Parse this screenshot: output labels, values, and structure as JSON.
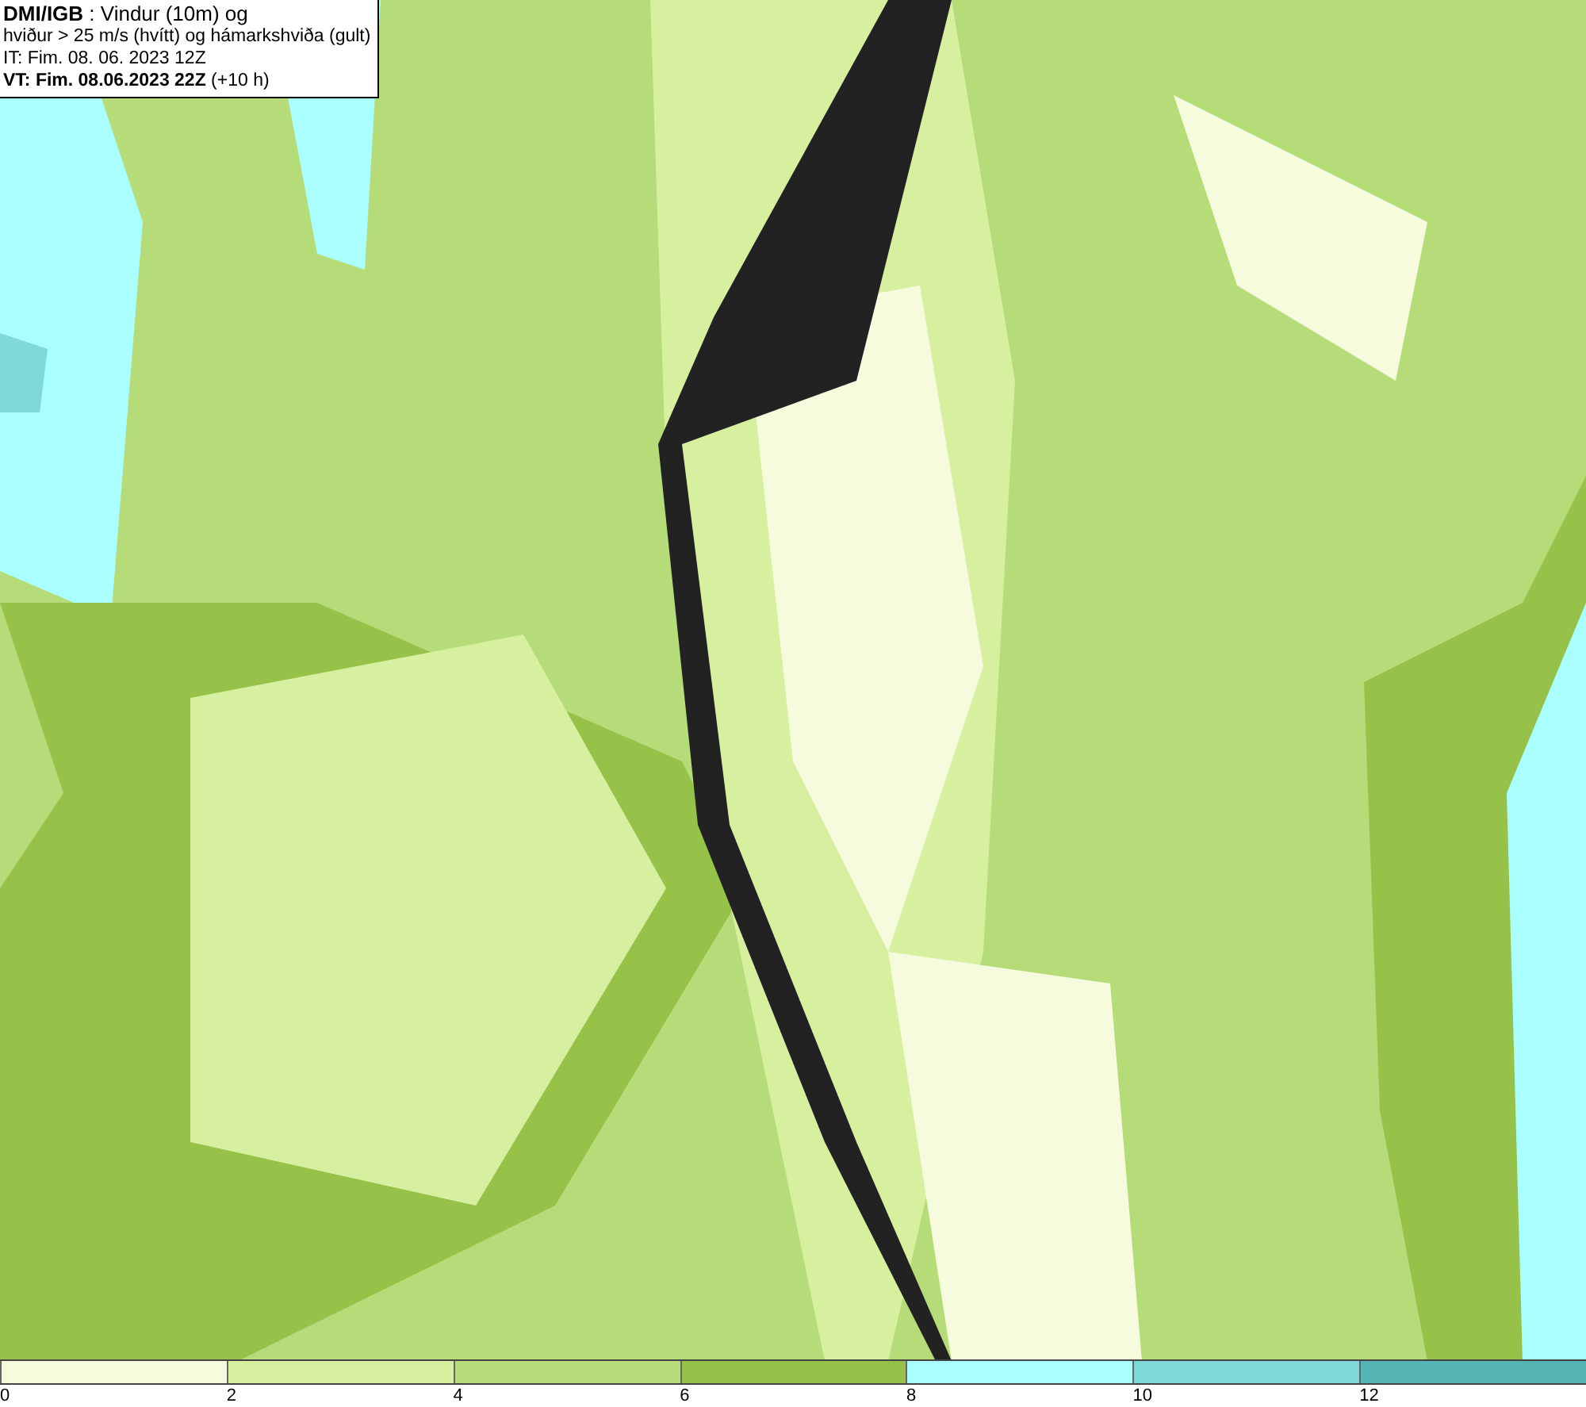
{
  "info_box": {
    "lines": [
      "**DMI/IGB** : Vindur (10m) og",
      "hviður > 25 m/s (hvítt) og hámarkshviða (gult)",
      "IT: Fim. 08. 06. 2023 12Z",
      "**VT: Fim. 08.06.2023 22Z** (+10 h)"
    ]
  },
  "legend": {
    "bins": [
      {
        "label": "0",
        "color": "#f5fbdc"
      },
      {
        "label": "2",
        "color": "#d6f0a0"
      },
      {
        "label": "4",
        "color": "#b5dc78"
      },
      {
        "label": "6",
        "color": "#96c24a"
      },
      {
        "label": "8",
        "color": "#aaffff"
      },
      {
        "label": "10",
        "color": "#7fd8d8"
      },
      {
        "label": "12",
        "color": "#55b4b4"
      }
    ]
  }
}
